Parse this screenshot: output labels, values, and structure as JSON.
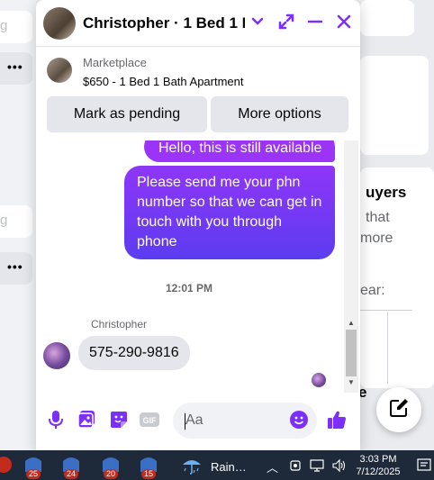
{
  "background": {
    "left_dots_1": "•••",
    "left_dots_2": "•••",
    "left_fragment_1": "g",
    "left_fragment_2": "g",
    "right_heading": "uyers",
    "right_line_1": "that",
    "right_line_2": "more",
    "right_line_3": "ear:",
    "right_fragment": "e"
  },
  "chat": {
    "title": "Christopher · 1 Bed 1 B…",
    "marketplace_label": "Marketplace",
    "listing_title": "$650 - 1 Bed 1 Bath Apartment",
    "buttons": {
      "pending": "Mark as pending",
      "more": "More options"
    },
    "messages": {
      "outgoing_1": "Hello, this is still available",
      "outgoing_2": "Please send me your phn number so that we can get in touch with you through phone",
      "timestamp": "12:01 PM",
      "sender": "Christopher",
      "incoming_1": "575-290-9816"
    },
    "composer": {
      "placeholder": "Aa"
    },
    "accent_color": "#7b2ff7",
    "icons": [
      "microphone-icon",
      "image-icon",
      "sticker-icon",
      "gif-icon",
      "emoji-icon",
      "thumbs-up-icon"
    ]
  },
  "taskbar": {
    "badges": [
      "25",
      "24",
      "20",
      "15"
    ],
    "weather": "Rain…",
    "time": "3:03 PM",
    "date": "7/12/2025"
  }
}
